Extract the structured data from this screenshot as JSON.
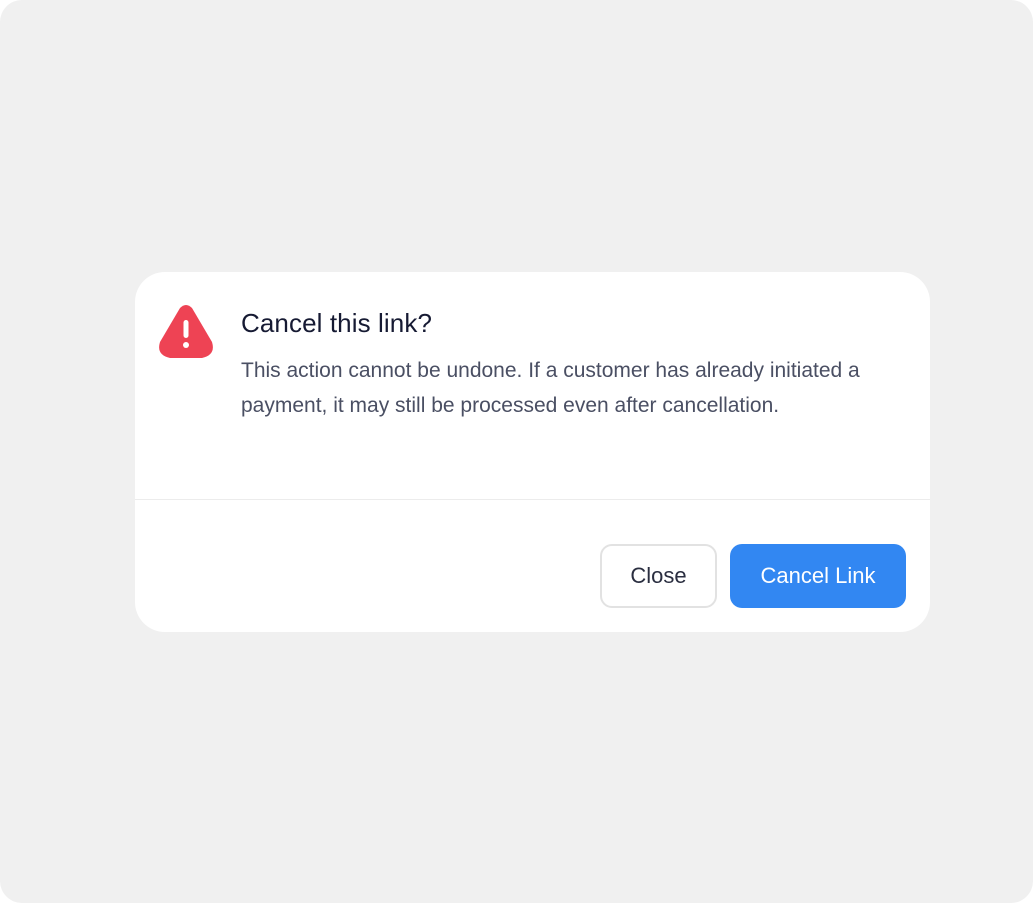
{
  "dialog": {
    "title": "Cancel this link?",
    "message": "This action cannot be undone. If a customer has already initiated a payment, it may still be processed even after cancellation.",
    "icon": "warning-triangle-icon",
    "close_label": "Close",
    "confirm_label": "Cancel Link"
  },
  "colors": {
    "backdrop": "#f0f0f0",
    "warning": "#ee4354",
    "primary": "#3287f2",
    "title": "#161a33",
    "body_text": "#4a4f63"
  }
}
